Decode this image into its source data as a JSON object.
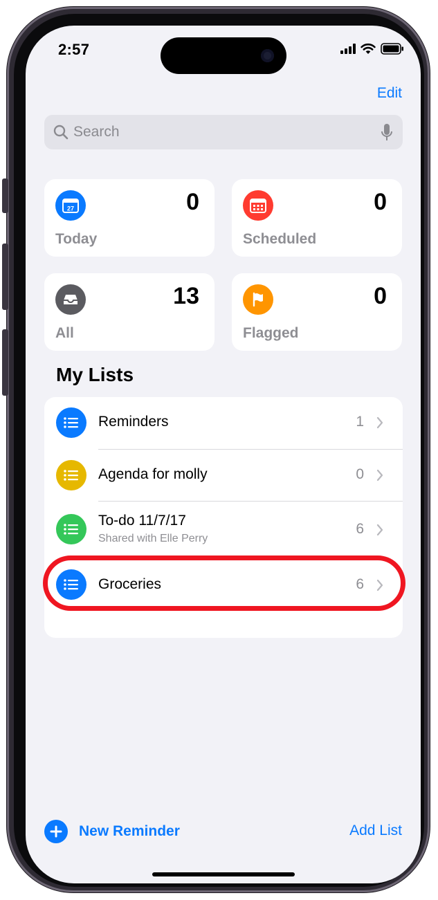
{
  "status_bar": {
    "time": "2:57"
  },
  "header": {
    "edit_label": "Edit"
  },
  "search": {
    "placeholder": "Search",
    "value": ""
  },
  "smart_lists": [
    {
      "label": "Today",
      "count": "0",
      "icon": "calendar-icon",
      "color": "#0a7aff",
      "icon_text": "27"
    },
    {
      "label": "Scheduled",
      "count": "0",
      "icon": "calendar-grid-icon",
      "color": "#ff3b30"
    },
    {
      "label": "All",
      "count": "13",
      "icon": "tray-icon",
      "color": "#5b5b60"
    },
    {
      "label": "Flagged",
      "count": "0",
      "icon": "flag-icon",
      "color": "#ff9500"
    }
  ],
  "my_lists": {
    "title": "My Lists",
    "items": [
      {
        "name": "Reminders",
        "count": "1",
        "color": "#0a7aff",
        "icon": "list-bullet-icon"
      },
      {
        "name": "Agenda for molly",
        "count": "0",
        "color": "#e6b800",
        "icon": "list-bullet-icon"
      },
      {
        "name": "To-do 11/7/17",
        "subtitle": "Shared with Elle Perry",
        "count": "6",
        "color": "#34c759",
        "icon": "list-bullet-icon"
      },
      {
        "name": "Groceries",
        "count": "6",
        "color": "#0a7aff",
        "icon": "list-bullet-icon",
        "highlighted": true
      }
    ]
  },
  "toolbar": {
    "new_reminder_label": "New Reminder",
    "add_list_label": "Add List"
  },
  "colors": {
    "accent": "#0a7aff",
    "highlight_ring": "#ef1621",
    "background": "#f2f2f7"
  }
}
